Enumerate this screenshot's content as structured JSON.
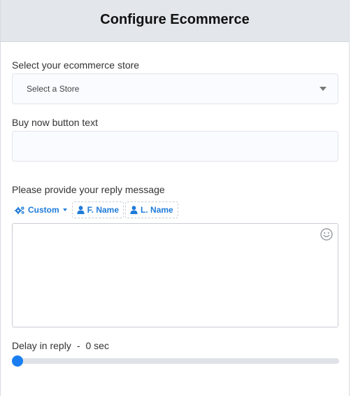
{
  "header": {
    "title": "Configure Ecommerce"
  },
  "store": {
    "label": "Select your ecommerce store",
    "selected": "Select a Store"
  },
  "buy_now": {
    "label": "Buy now button text",
    "value": "",
    "placeholder": ""
  },
  "reply": {
    "label": "Please provide your reply message",
    "toolbar": {
      "custom": "Custom",
      "first_name": "F. Name",
      "last_name": "L. Name"
    },
    "message": ""
  },
  "delay": {
    "label": "Delay in reply",
    "separator": "-",
    "value_text": "0 sec",
    "level": 0
  },
  "colors": {
    "accent": "#1a7ef2",
    "link": "#1f7bd8",
    "header_bg": "#e3e6ea"
  },
  "icons": {
    "custom": "cogs-icon",
    "first_name": "user-icon",
    "last_name": "user-icon",
    "emoji": "smiley-icon"
  }
}
